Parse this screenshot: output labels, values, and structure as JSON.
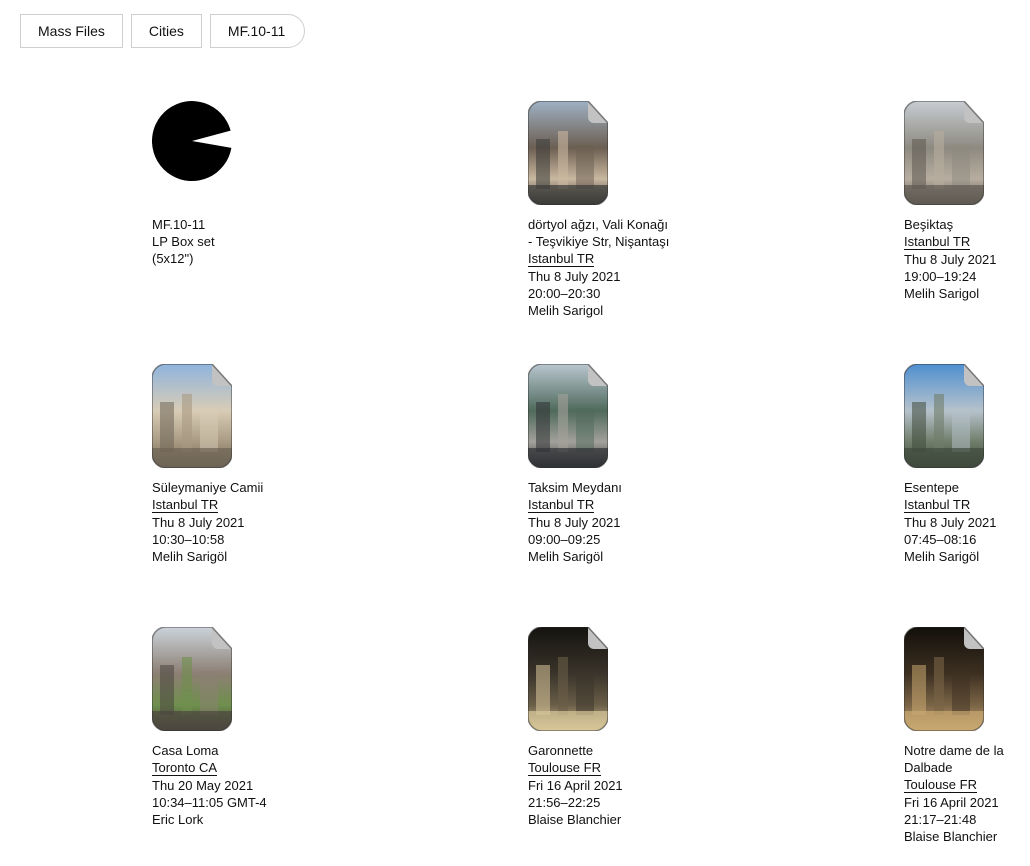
{
  "breadcrumb": [
    "Mass Files",
    "Cities",
    "MF.10-11"
  ],
  "release": {
    "icon": "pie-logo-icon",
    "lines": [
      "MF.10-11",
      "LP Box set",
      "(5x12\")"
    ]
  },
  "items": [
    {
      "title": "dörtyol ağzı, Vali Konağı",
      "title2": "- Teşvikiye Str, Nişantaşı",
      "location": "Istanbul TR",
      "date": "Thu 8 July 2021",
      "time": "20:00–20:30",
      "author": "Melih Sarigol",
      "palette": [
        "#9fb1c4",
        "#6c5f52",
        "#c9b8a0",
        "#3b3a38"
      ]
    },
    {
      "title": "Beşiktaş",
      "location": "Istanbul TR",
      "date": "Thu 8 July 2021",
      "time": "19:00–19:24",
      "author": "Melih Sarigol",
      "palette": [
        "#c8cdd3",
        "#8d8a80",
        "#b7ad9f",
        "#5e5a52"
      ]
    },
    {
      "title": "Süleymaniye Camii",
      "location": "Istanbul TR",
      "date": "Thu 8 July 2021",
      "time": "10:30–10:58",
      "author": "Melih Sarigöl",
      "palette": [
        "#8fb4dd",
        "#d8ccb6",
        "#a89a82",
        "#6e6455"
      ]
    },
    {
      "title": "Taksim Meydanı",
      "location": "Istanbul TR",
      "date": "Thu 8 July 2021",
      "time": "09:00–09:25",
      "author": "Melih Sarigöl",
      "palette": [
        "#b9c6cf",
        "#4f6a5c",
        "#a3a19a",
        "#2f3134"
      ]
    },
    {
      "title": "Esentepe",
      "location": "Istanbul TR",
      "date": "Thu 8 July 2021",
      "time": "07:45–08:16",
      "author": "Melih Sarigöl",
      "palette": [
        "#4f8fd0",
        "#b6c2cb",
        "#6f7d6a",
        "#3f4a3c"
      ]
    },
    {
      "title": "Casa Loma",
      "location": "Toronto CA",
      "date": "Thu 20 May 2021",
      "time": "10:34–11:05 GMT-4",
      "author": "Eric Lork",
      "palette": [
        "#cbd3da",
        "#8c7f73",
        "#6f8f4d",
        "#4b463f"
      ]
    },
    {
      "title": "Garonnette",
      "location": "Toulouse FR",
      "date": "Fri 16 April 2021",
      "time": "21:56–22:25",
      "author": "Blaise Blanchier",
      "palette": [
        "#14130f",
        "#3a342a",
        "#6a5e48",
        "#d9c79a"
      ]
    },
    {
      "title": "Notre dame de la",
      "title2": "Dalbade",
      "location": "Toulouse FR",
      "date": "Fri 16 April 2021",
      "time": "21:17–21:48",
      "author": "Blaise Blanchier",
      "palette": [
        "#120f0a",
        "#3d3021",
        "#7a6446",
        "#c9a870"
      ]
    }
  ]
}
